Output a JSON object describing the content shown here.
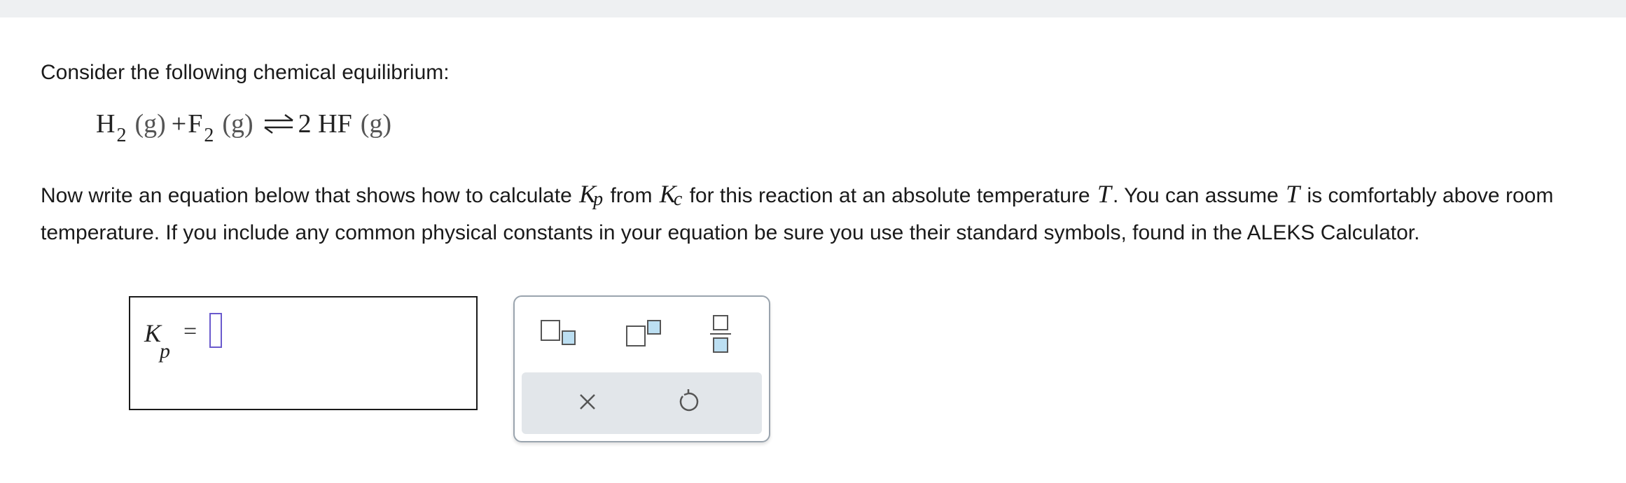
{
  "problem": {
    "intro": "Consider the following chemical equilibrium:",
    "equation": {
      "r1_symbol": "H",
      "r1_sub": "2",
      "r1_state": "(g)",
      "plus": "+",
      "r2_symbol": "F",
      "r2_sub": "2",
      "r2_state": "(g)",
      "product": "2 HF",
      "product_state": "(g)"
    },
    "instruction": {
      "part1": "Now write an equation below that shows how to calculate ",
      "kp_symbol": "K",
      "kp_sub": "p",
      "part2": " from ",
      "kc_symbol": "K",
      "kc_sub": "c",
      "part3": " for this reaction at an absolute temperature ",
      "t_symbol": "T",
      "part4": ". You can assume ",
      "t_symbol2": "T",
      "part5": " is comfortably above room temperature. If you include any common physical constants in your equation be sure you use their standard symbols, found in the ALEKS Calculator."
    }
  },
  "answer": {
    "lhs_symbol": "K",
    "lhs_sub": "p",
    "equals": "="
  },
  "palette": {
    "buttons": [
      "subscript-icon",
      "superscript-icon",
      "fraction-icon",
      "clear-icon",
      "undo-icon"
    ]
  },
  "colors": {
    "cursor_border": "#6a5acd",
    "palette_square": "#bcdff2",
    "palette_bottom_bg": "#e2e6ea"
  }
}
